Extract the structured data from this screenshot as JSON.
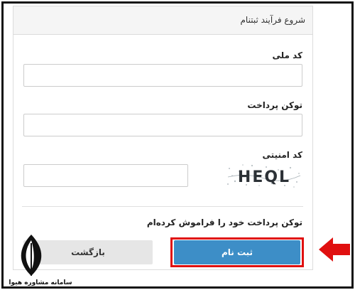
{
  "panel": {
    "title": "شروع فرآیند ثبتنام"
  },
  "form": {
    "national_code_label": "کد ملی",
    "national_code_value": "",
    "payment_token_label": "توکن پرداخت",
    "payment_token_value": "",
    "security_code_label": "کد امنیتی",
    "security_code_value": "",
    "captcha_text": "HEQL"
  },
  "forgot_token_link": "توکن پرداخت خود را فراموش کرده‌ام",
  "buttons": {
    "register_label": "ثبت نام",
    "back_label": "بازگشت"
  },
  "watermark": {
    "text": "سامانه مشاوره هیوا"
  },
  "colors": {
    "register_button": "#3d8ec7",
    "highlight_outline": "#e01010",
    "arrow": "#e01010"
  },
  "icons": {
    "arrow": "left-arrow-icon",
    "logo": "feather-logo-icon"
  }
}
